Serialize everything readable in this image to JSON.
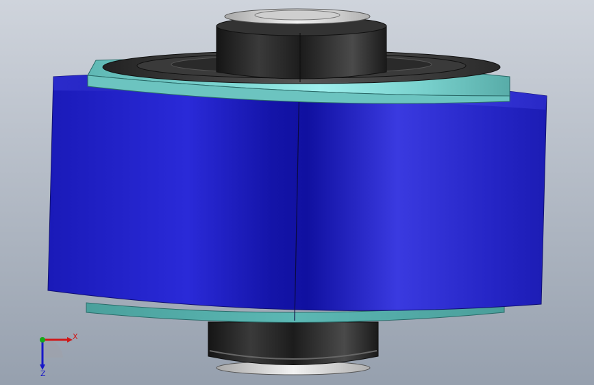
{
  "viewport": {
    "background_top": "#c9ced6",
    "background_bottom": "#9aa3b1"
  },
  "model": {
    "outer_sleeve_color": "#2020c8",
    "flange_color": "#6ec8c4",
    "rubber_color": "#2a2a2a",
    "washer_color": "#d8d8d8"
  },
  "triad": {
    "x_label": "X",
    "z_label": "Z",
    "x_color": "#d01818",
    "y_color": "#18a818",
    "z_color": "#1818c8"
  }
}
